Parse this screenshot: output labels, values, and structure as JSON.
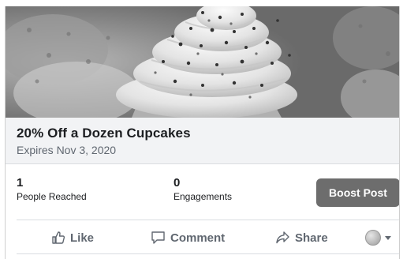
{
  "offer": {
    "title": "20% Off a Dozen Cupcakes",
    "expiry": "Expires Nov 3, 2020"
  },
  "stats": {
    "reached_value": "1",
    "reached_label": "People Reached",
    "engagements_value": "0",
    "engagements_label": "Engagements"
  },
  "boost": {
    "label": "Boost Post"
  },
  "actions": {
    "like": {
      "label": "Like",
      "icon": "thumbs-up-icon"
    },
    "comment": {
      "label": "Comment",
      "icon": "comment-icon"
    },
    "share": {
      "label": "Share",
      "icon": "share-icon"
    },
    "audience": {
      "icon": "globe-icon"
    }
  },
  "colors": {
    "boost_button": "#6d6d6d",
    "action_text": "#606770",
    "info_background": "#f2f3f5"
  }
}
